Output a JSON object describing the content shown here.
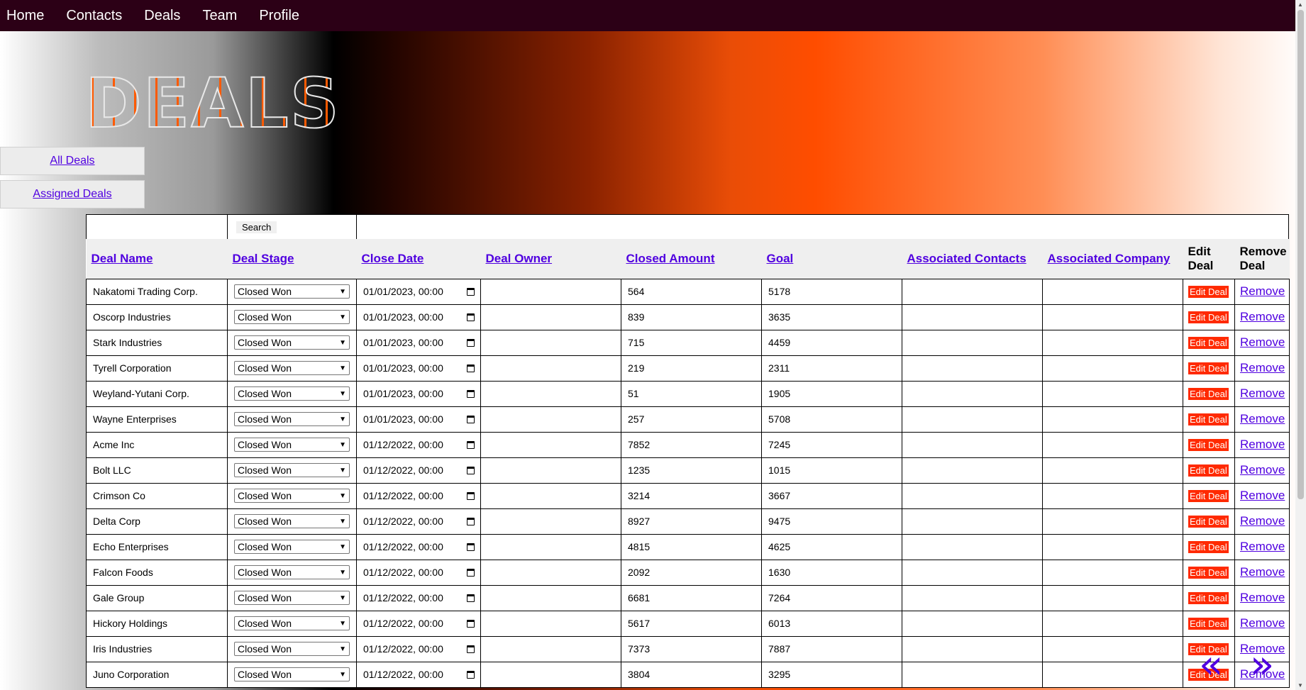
{
  "nav": {
    "items": [
      "Home",
      "Contacts",
      "Deals",
      "Team",
      "Profile"
    ]
  },
  "logo": {
    "text": "DEALS"
  },
  "sidebar": {
    "all_deals": "All Deals",
    "assigned_deals": "Assigned Deals"
  },
  "search": {
    "value": "",
    "button": "Search"
  },
  "table": {
    "headers": {
      "deal_name": "Deal Name",
      "deal_stage": "Deal Stage",
      "close_date": "Close Date",
      "deal_owner": "Deal Owner",
      "closed_amount": "Closed Amount",
      "goal": "Goal",
      "associated_contacts": "Associated Contacts",
      "associated_company": "Associated Company",
      "edit_deal": "Edit Deal",
      "remove_deal": "Remove Deal"
    },
    "edit_label": "Edit Deal",
    "remove_label": "Remove",
    "rows": [
      {
        "name": "Nakatomi Trading Corp.",
        "stage": "Closed Won",
        "date": "01/01/2023, 00:00",
        "owner": "",
        "amount": "564",
        "goal": "5178",
        "contacts": "",
        "company": ""
      },
      {
        "name": "Oscorp Industries",
        "stage": "Closed Won",
        "date": "01/01/2023, 00:00",
        "owner": "",
        "amount": "839",
        "goal": "3635",
        "contacts": "",
        "company": ""
      },
      {
        "name": "Stark Industries",
        "stage": "Closed Won",
        "date": "01/01/2023, 00:00",
        "owner": "",
        "amount": "715",
        "goal": "4459",
        "contacts": "",
        "company": ""
      },
      {
        "name": "Tyrell Corporation",
        "stage": "Closed Won",
        "date": "01/01/2023, 00:00",
        "owner": "",
        "amount": "219",
        "goal": "2311",
        "contacts": "",
        "company": ""
      },
      {
        "name": "Weyland-Yutani Corp.",
        "stage": "Closed Won",
        "date": "01/01/2023, 00:00",
        "owner": "",
        "amount": "51",
        "goal": "1905",
        "contacts": "",
        "company": ""
      },
      {
        "name": "Wayne Enterprises",
        "stage": "Closed Won",
        "date": "01/01/2023, 00:00",
        "owner": "",
        "amount": "257",
        "goal": "5708",
        "contacts": "",
        "company": ""
      },
      {
        "name": "Acme Inc",
        "stage": "Closed Won",
        "date": "01/12/2022, 00:00",
        "owner": "",
        "amount": "7852",
        "goal": "7245",
        "contacts": "",
        "company": ""
      },
      {
        "name": "Bolt LLC",
        "stage": "Closed Won",
        "date": "01/12/2022, 00:00",
        "owner": "",
        "amount": "1235",
        "goal": "1015",
        "contacts": "",
        "company": ""
      },
      {
        "name": "Crimson Co",
        "stage": "Closed Won",
        "date": "01/12/2022, 00:00",
        "owner": "",
        "amount": "3214",
        "goal": "3667",
        "contacts": "",
        "company": ""
      },
      {
        "name": "Delta Corp",
        "stage": "Closed Won",
        "date": "01/12/2022, 00:00",
        "owner": "",
        "amount": "8927",
        "goal": "9475",
        "contacts": "",
        "company": ""
      },
      {
        "name": "Echo Enterprises",
        "stage": "Closed Won",
        "date": "01/12/2022, 00:00",
        "owner": "",
        "amount": "4815",
        "goal": "4625",
        "contacts": "",
        "company": ""
      },
      {
        "name": "Falcon Foods",
        "stage": "Closed Won",
        "date": "01/12/2022, 00:00",
        "owner": "",
        "amount": "2092",
        "goal": "1630",
        "contacts": "",
        "company": ""
      },
      {
        "name": "Gale Group",
        "stage": "Closed Won",
        "date": "01/12/2022, 00:00",
        "owner": "",
        "amount": "6681",
        "goal": "7264",
        "contacts": "",
        "company": ""
      },
      {
        "name": "Hickory Holdings",
        "stage": "Closed Won",
        "date": "01/12/2022, 00:00",
        "owner": "",
        "amount": "5617",
        "goal": "6013",
        "contacts": "",
        "company": ""
      },
      {
        "name": "Iris Industries",
        "stage": "Closed Won",
        "date": "01/12/2022, 00:00",
        "owner": "",
        "amount": "7373",
        "goal": "7887",
        "contacts": "",
        "company": ""
      },
      {
        "name": "Juno Corporation",
        "stage": "Closed Won",
        "date": "01/12/2022, 00:00",
        "owner": "",
        "amount": "3804",
        "goal": "3295",
        "contacts": "",
        "company": ""
      }
    ]
  },
  "pager": {
    "prev": "«",
    "next": "»"
  },
  "colors": {
    "nav_bg": "#2c0016",
    "link": "#5000e0",
    "edit_button": "#ff2a00",
    "accent_orange": "#ff4d00"
  }
}
